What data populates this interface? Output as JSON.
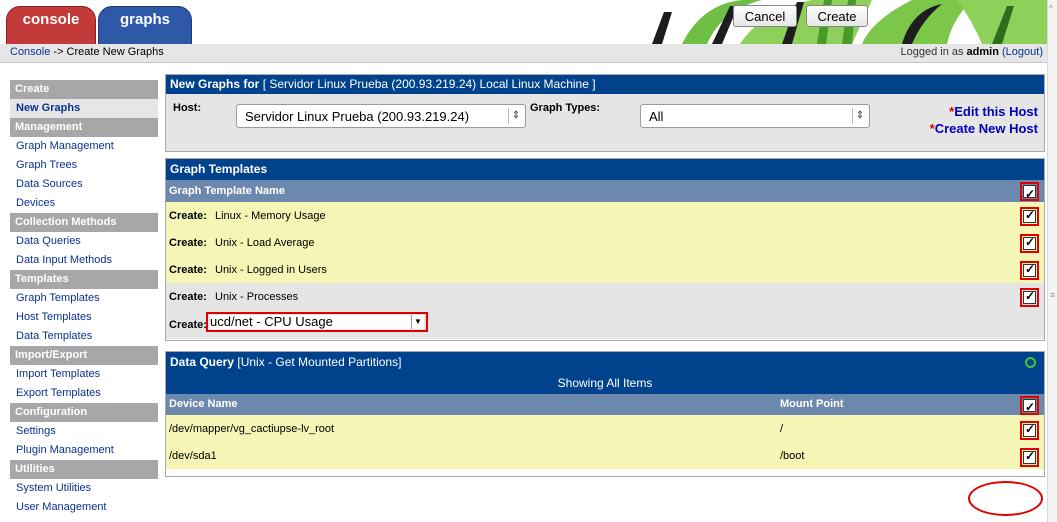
{
  "tabs": {
    "console": "console",
    "graphs": "graphs"
  },
  "nav": {
    "breadcrumb_link": "Console",
    "breadcrumb_rest": " -> Create New Graphs",
    "login_prefix": "Logged in as ",
    "login_user": "admin",
    "logout_label": "(Logout)"
  },
  "sidebar": {
    "sections": [
      {
        "header": "Create",
        "items": [
          "New Graphs"
        ]
      },
      {
        "header": "Management",
        "items": [
          "Graph Management",
          "Graph Trees",
          "Data Sources",
          "Devices"
        ]
      },
      {
        "header": "Collection Methods",
        "items": [
          "Data Queries",
          "Data Input Methods"
        ]
      },
      {
        "header": "Templates",
        "items": [
          "Graph Templates",
          "Host Templates",
          "Data Templates"
        ]
      },
      {
        "header": "Import/Export",
        "items": [
          "Import Templates",
          "Export Templates"
        ]
      },
      {
        "header": "Configuration",
        "items": [
          "Settings",
          "Plugin Management"
        ]
      },
      {
        "header": "Utilities",
        "items": [
          "System Utilities",
          "User Management"
        ]
      }
    ],
    "active_item": "New Graphs"
  },
  "new_graphs": {
    "title_prefix": "New Graphs for",
    "title_host": " [ Servidor Linux Prueba (200.93.219.24) Local Linux Machine ]",
    "host_label": "Host:",
    "host_value": "Servidor Linux Prueba (200.93.219.24)",
    "graph_types_label": "Graph Types:",
    "graph_types_value": "All",
    "edit_host_star": "*",
    "edit_host_label": "Edit this Host",
    "create_host_star": "*",
    "create_host_label": "Create New Host"
  },
  "graph_templates": {
    "title": "Graph Templates",
    "column_header": "Graph Template Name",
    "create_label": "Create:",
    "rows": [
      "Linux - Memory Usage",
      "Unix - Load Average",
      "Unix - Logged in Users",
      "Unix - Processes"
    ],
    "dropdown_label": "Create:",
    "dropdown_value": "ucd/net - CPU Usage"
  },
  "data_query": {
    "title_prefix": "Data Query",
    "title_name": " [Unix - Get Mounted Partitions]",
    "showing_label": "Showing All Items",
    "col_device": "Device Name",
    "col_mount": "Mount Point",
    "rows": [
      {
        "device": "/dev/mapper/vg_cactiupse-lv_root",
        "mount": "/"
      },
      {
        "device": "/dev/sda1",
        "mount": "/boot"
      }
    ]
  },
  "buttons": {
    "cancel": "Cancel",
    "create": "Create"
  },
  "colors": {
    "header_blue": "#00438c",
    "subheader_blue": "#6d88ad",
    "row_yellow": "#f5f5b6",
    "highlight_red": "#e00000",
    "menu_header_grey": "#a7a7a7"
  }
}
